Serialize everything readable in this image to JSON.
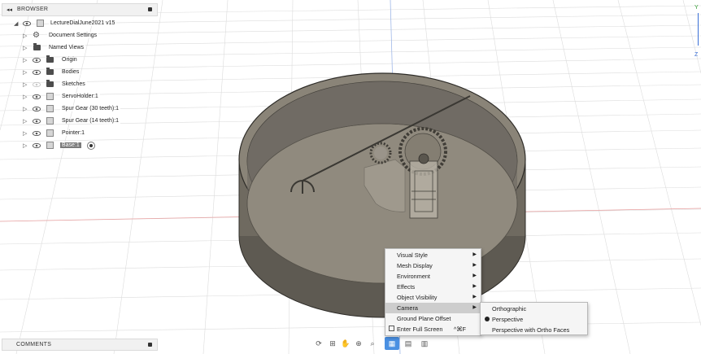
{
  "browser": {
    "title": "BROWSER",
    "root": {
      "label": "LectureDialJune2021 v15"
    },
    "items": [
      {
        "label": "Document Settings"
      },
      {
        "label": "Named Views"
      },
      {
        "label": "Origin"
      },
      {
        "label": "Bodies"
      },
      {
        "label": "Sketches"
      },
      {
        "label": "ServoHolder:1"
      },
      {
        "label": "Spur Gear (30 teeth):1"
      },
      {
        "label": "Spur Gear (14 teeth):1"
      },
      {
        "label": "Pointer:1"
      },
      {
        "label": "Base:1"
      }
    ]
  },
  "comments": {
    "title": "COMMENTS"
  },
  "context_menu": {
    "items": [
      {
        "label": "Visual Style"
      },
      {
        "label": "Mesh Display"
      },
      {
        "label": "Environment"
      },
      {
        "label": "Effects"
      },
      {
        "label": "Object Visibility"
      },
      {
        "label": "Camera"
      },
      {
        "label": "Ground Plane Offset"
      },
      {
        "label": "Enter Full Screen",
        "shortcut": "^⌘F"
      }
    ]
  },
  "camera_submenu": {
    "items": [
      {
        "label": "Orthographic"
      },
      {
        "label": "Perspective",
        "selected": true
      },
      {
        "label": "Perspective with Ortho Faces"
      }
    ]
  },
  "viewcube": {
    "axis_y": "Y",
    "axis_z": "Z"
  },
  "colors": {
    "selection": "#4a90e2",
    "grid": "#d9d9d9",
    "grid_axis": "#e6a5a5",
    "model": "#8a8478"
  }
}
